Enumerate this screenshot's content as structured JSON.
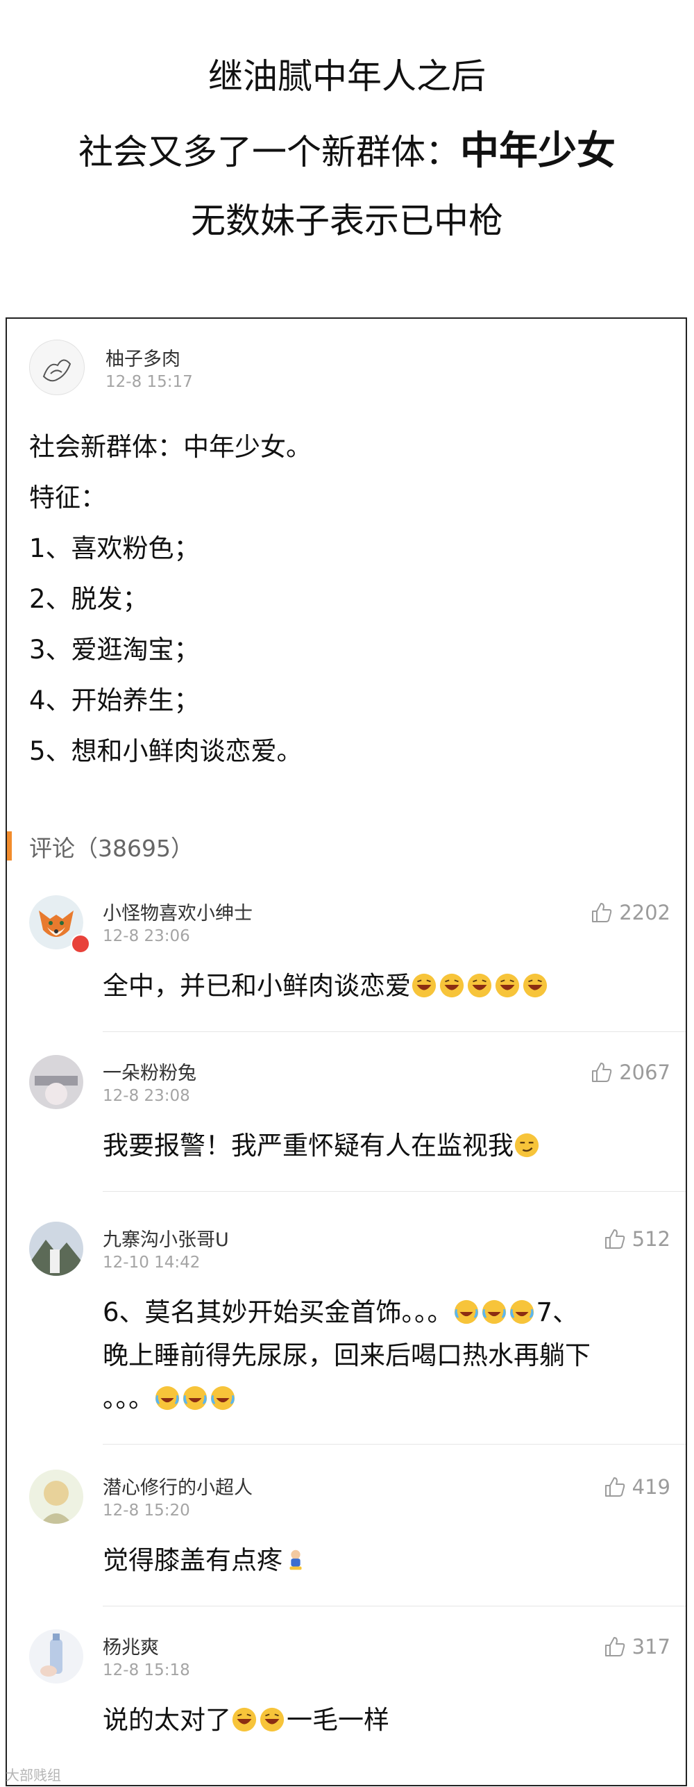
{
  "headline": {
    "line1": "继油腻中年人之后",
    "line2_prefix": "社会又多了一个新群体：",
    "line2_bold": "中年少女",
    "line3": "无数妹子表示已中枪"
  },
  "post": {
    "author": "柚子多肉",
    "time": "12-8 15:17",
    "lines": [
      "社会新群体：中年少女。",
      "特征：",
      "1、喜欢粉色；",
      "2、脱发；",
      "3、爱逛淘宝；",
      "4、开始养生；",
      "5、想和小鲜肉谈恋爱。"
    ]
  },
  "comments_header": "评论（38695）",
  "comments": [
    {
      "name": "小怪物喜欢小绅士",
      "time": "12-8 23:06",
      "likes": "2202",
      "text": "全中，并已和小鲜肉谈恋爱",
      "avatar": "fox-avatar"
    },
    {
      "name": "一朵粉粉兔",
      "time": "12-8 23:08",
      "likes": "2067",
      "text": "我要报警！我严重怀疑有人在监视我",
      "avatar": "photo-avatar"
    },
    {
      "name": "九寨沟小张哥U",
      "time": "12-10 14:42",
      "likes": "512",
      "text1": "6、莫名其妙开始买金首饰。。。",
      "text2": "7、",
      "text3": "晚上睡前得先尿尿，回来后喝口热水再躺下",
      "text4": "。。。",
      "avatar": "mountain-avatar"
    },
    {
      "name": "潜心修行的小超人",
      "time": "12-8 15:20",
      "likes": "419",
      "text": "觉得膝盖有点疼",
      "avatar": "cartoon-avatar"
    },
    {
      "name": "杨兆爽",
      "time": "12-8 15:18",
      "likes": "317",
      "text_a": "说的太对了",
      "text_b": "一毛一样",
      "avatar": "bottle-avatar"
    }
  ],
  "colors": {
    "accent": "#f28c2c",
    "meta_gray": "#a4a4a4",
    "like_gray": "#9b9b9b",
    "text": "#111111"
  },
  "watermark": "大部贱组"
}
